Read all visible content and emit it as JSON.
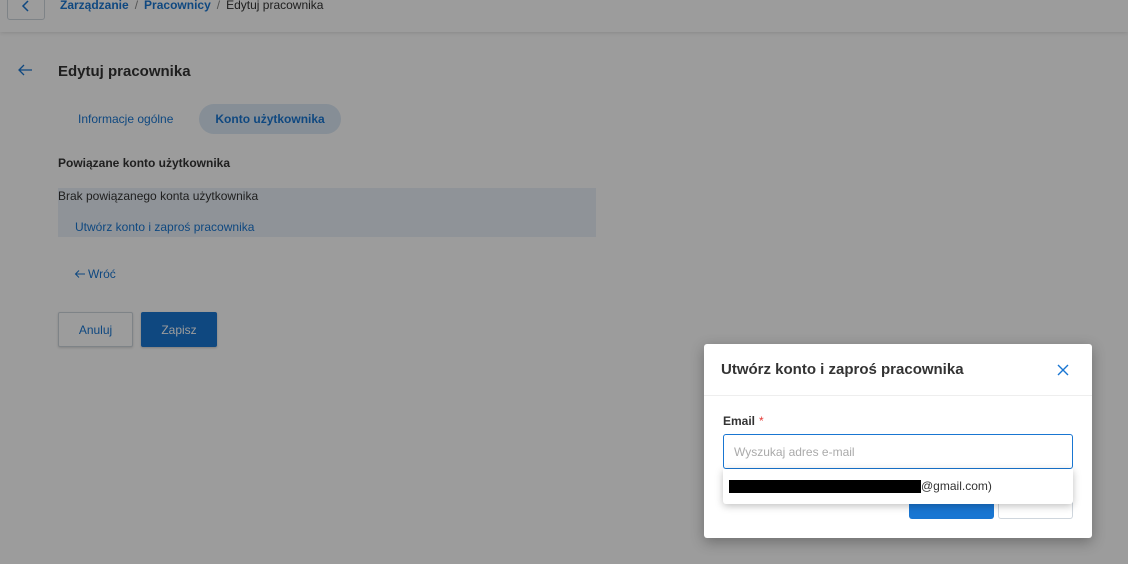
{
  "breadcrumb": {
    "items": [
      "Zarządzanie",
      "Pracownicy"
    ],
    "current": "Edytuj pracownika",
    "separator": "/"
  },
  "page": {
    "title": "Edytuj pracownika",
    "tabs": [
      {
        "label": "Informacje ogólne",
        "active": false
      },
      {
        "label": "Konto użytkownika",
        "active": true
      }
    ],
    "section_label": "Powiązane konto użytkownika",
    "info_text": "Brak powiązanego konta użytkownika",
    "info_link": "Utwórz konto i zaproś pracownika",
    "back_link": "Wróć",
    "cancel_label": "Anuluj",
    "save_label": "Zapisz"
  },
  "dialog": {
    "title": "Utwórz konto i zaproś pracownika",
    "field_label": "Email",
    "required_mark": "*",
    "input_value": "",
    "input_placeholder": "Wyszukaj adres e-mail",
    "dropdown_suffix": "@gmail.com)"
  },
  "colors": {
    "accent": "#1976d2",
    "required": "#e53935",
    "tab_active_bg": "#dbe8f5",
    "info_bg": "#eaf1f8"
  }
}
